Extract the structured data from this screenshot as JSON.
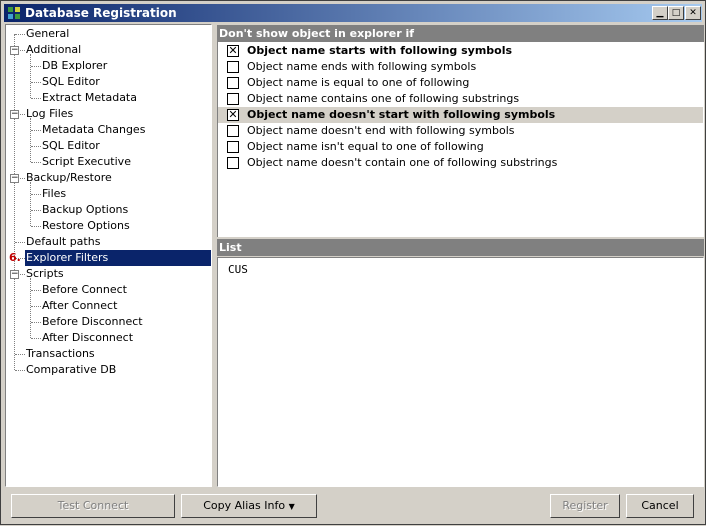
{
  "window": {
    "title": "Database Registration"
  },
  "tree": {
    "items": [
      {
        "label": "General"
      },
      {
        "label": "Additional"
      },
      {
        "label": "DB Explorer"
      },
      {
        "label": "SQL Editor"
      },
      {
        "label": "Extract Metadata"
      },
      {
        "label": "Log Files"
      },
      {
        "label": "Metadata Changes"
      },
      {
        "label": "SQL Editor"
      },
      {
        "label": "Script Executive"
      },
      {
        "label": "Backup/Restore"
      },
      {
        "label": "Files"
      },
      {
        "label": "Backup Options"
      },
      {
        "label": "Restore Options"
      },
      {
        "label": "Default paths"
      },
      {
        "label": "Explorer Filters"
      },
      {
        "label": "Scripts"
      },
      {
        "label": "Before Connect"
      },
      {
        "label": "After Connect"
      },
      {
        "label": "Before Disconnect"
      },
      {
        "label": "After Disconnect"
      },
      {
        "label": "Transactions"
      },
      {
        "label": "Comparative DB"
      }
    ],
    "selected_marker": "6."
  },
  "filters": {
    "header": "Don't show object in explorer if",
    "options": [
      {
        "label": "Object name starts with following symbols",
        "checked": true
      },
      {
        "label": "Object name ends with following symbols",
        "checked": false
      },
      {
        "label": "Object name is equal to one of following",
        "checked": false
      },
      {
        "label": "Object name contains one of following substrings",
        "checked": false
      },
      {
        "label": "Object name doesn't start with following symbols",
        "checked": true
      },
      {
        "label": "Object name doesn't end with following symbols",
        "checked": false
      },
      {
        "label": "Object name isn't equal to one of following",
        "checked": false
      },
      {
        "label": "Object name doesn't contain one of following substrings",
        "checked": false
      }
    ]
  },
  "list": {
    "header": "List",
    "content": "CUS"
  },
  "buttons": {
    "test_connect": "Test Connect",
    "copy_alias": "Copy Alias Info",
    "register": "Register",
    "cancel": "Cancel"
  },
  "checkmark": "✕",
  "colors": {
    "selection": "#0a246a",
    "header": "#808080",
    "marker": "#c00000"
  }
}
